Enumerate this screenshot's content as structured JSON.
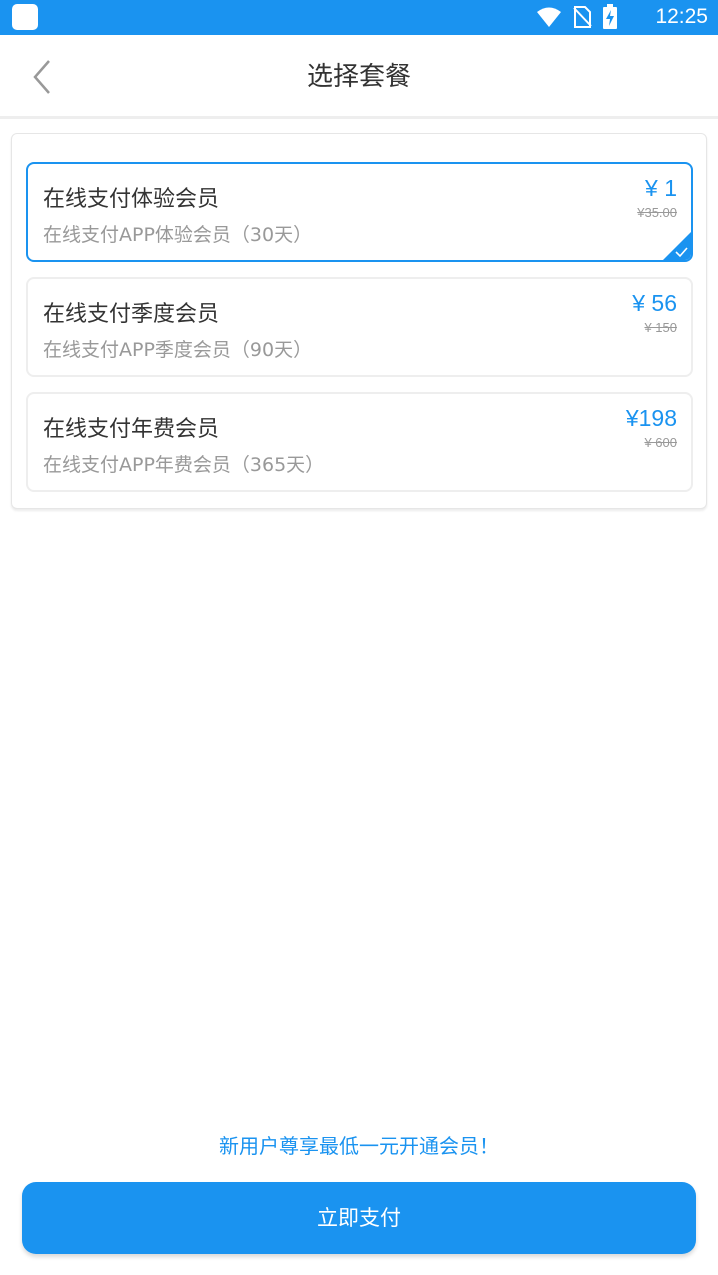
{
  "status_bar": {
    "time": "12:25",
    "icons": [
      "app-icon",
      "wifi-icon",
      "no-sim-icon",
      "battery-charging-icon"
    ]
  },
  "header": {
    "title": "选择套餐"
  },
  "plans": [
    {
      "name": "在线支付体验会员",
      "desc": "在线支付APP体验会员（30天）",
      "price": "¥ 1",
      "original_price": "¥35.00",
      "selected": true
    },
    {
      "name": "在线支付季度会员",
      "desc": "在线支付APP季度会员（90天）",
      "price": "¥ 56",
      "original_price": "¥ 150",
      "selected": false
    },
    {
      "name": "在线支付年费会员",
      "desc": "在线支付APP年费会员（365天）",
      "price": "¥198",
      "original_price": "¥ 600",
      "selected": false
    }
  ],
  "footer": {
    "promo": "新用户尊享最低一元开通会员！",
    "pay_button": "立即支付"
  },
  "colors": {
    "accent": "#1a93f0",
    "status_bar": "#1a93f0"
  }
}
